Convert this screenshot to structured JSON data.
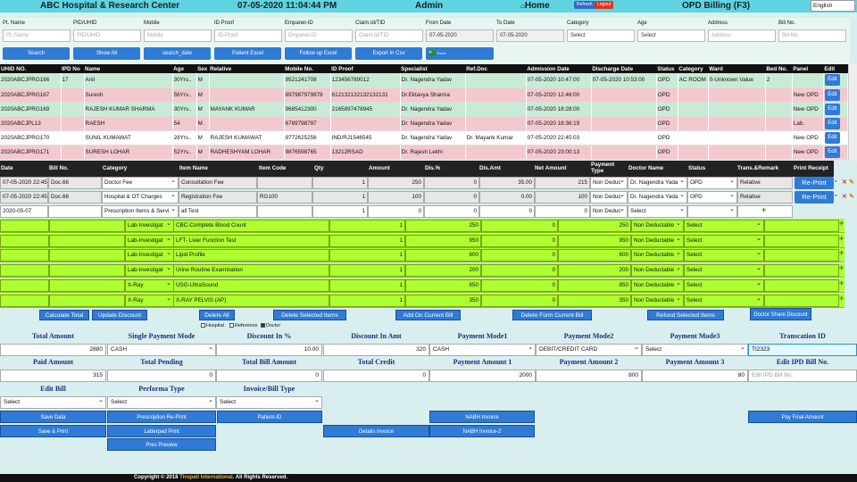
{
  "header": {
    "title": "ABC Hospital & Research Center",
    "datetime": "07-05-2020 11:04:44 PM",
    "user": "Admin",
    "home": "Home",
    "refresh": "Refresh",
    "logout": "Logout",
    "page": "OPD Billing (F3)",
    "language": "English"
  },
  "filters": {
    "labels": [
      "Pt. Name",
      "PID/UHID",
      "Mobile",
      "ID Proof",
      "Empanel-ID",
      "Claim.Id/TID",
      "From Date",
      "To Date",
      "Category",
      "Age",
      "Address",
      "Bill No."
    ],
    "placeholders": [
      "Pt. Name",
      "PID/UHID",
      "Mobile",
      "ID-Proof",
      "Empanel-ID",
      "Claim.Id/TID",
      "07-05-2020",
      "07-05-2020",
      "Select",
      "Select",
      "Address",
      "Bill No."
    ],
    "buttons": [
      "Search",
      "Show All",
      "search_date",
      "Patient Excel",
      "Follow up Excel",
      "Export In Csv",
      "Excel"
    ]
  },
  "patients": {
    "headers": [
      "UHID NO.",
      "IPD No",
      "Name",
      "Age",
      "Sex",
      "Relative",
      "Mobile No.",
      "ID Proof",
      "Specialist",
      "Ref.Doc",
      "Admission Date",
      "Discharge Date",
      "Status",
      "Category",
      "Ward",
      "Bed No.",
      "Panel",
      "Edit"
    ],
    "rows": [
      [
        "2020ABCJPRG166",
        "17",
        "Anil",
        "30Yrs..",
        "M",
        "",
        "9521241708",
        "123456789012",
        "Dr. Nagendra Yadav",
        "",
        "07-05-2020 10:47:00",
        "07-05-2020 10:53:00",
        "OPD",
        "AC ROOM",
        "0-Unknown Value",
        "2",
        "",
        "Edit"
      ],
      [
        "2020ABCJPRG167",
        "",
        "Suresh",
        "56Yrs..",
        "M",
        "",
        "897987979878",
        "612132132132132131",
        "Dr.Ektavya Sharma",
        "",
        "07-05-2020 12:46:00",
        "",
        "OPD",
        "",
        "",
        "",
        "New OPD",
        "Edit"
      ],
      [
        "2020ABCJPRG169",
        "",
        "RAJESH KUMAR SHARMA",
        "30Yrs..",
        "M",
        "MAYANK KUMAR",
        "9685412300",
        "2165897478945",
        "Dr. Nagendra Yadav",
        "",
        "07-05-2020 18:28:00",
        "",
        "OPD",
        "",
        "",
        "",
        "New OPD",
        "Edit"
      ],
      [
        "2020ABCJPL13",
        "",
        "RAESH",
        "54",
        "M",
        "",
        "6789798797",
        "",
        "Dr. Nagendra Yadav",
        "",
        "07-05-2020 18:36:19",
        "",
        "OPD",
        "",
        "",
        "",
        "Lab.",
        "Edit"
      ],
      [
        "2020ABCJPRG170",
        "",
        "SUNIL KUMAWAT",
        "28Yrs..",
        "M",
        "RAJESH KUMAWAT",
        "9772625256",
        "IND/RJ1546545",
        "Dr. Nagendra Yadav",
        "Dr. Mayank Kumar",
        "07-05-2020 22:45:03",
        "",
        "OPD",
        "",
        "",
        "",
        "New OPD",
        "Edit"
      ],
      [
        "2020ABCJPRG171",
        "",
        "SURESH LOHAR",
        "52Yrs..",
        "M",
        "RADHESHYAM LOHAR",
        "9876598765",
        "13212RSAD",
        "Dr. Rajesh Lekhi",
        "",
        "07-05-2020 23:00:13",
        "",
        "OPD",
        "",
        "",
        "",
        "New OPD",
        "Edit"
      ]
    ]
  },
  "billing": {
    "headers": [
      "Date",
      "Bill No.",
      "Category",
      "Item Name",
      "Item Code",
      "Qty",
      "Amount",
      "Dis.%",
      "Dis.Amt",
      "Net Amount",
      "Payment Type",
      "Doctor Name",
      "Status",
      "Trans.&Remark",
      "Print Receipt"
    ],
    "rows": [
      {
        "date": "07-05-2020 22:45",
        "bill": "Doc.66",
        "category": "Doctor Fee",
        "item": "Consultation Fee",
        "code": "",
        "qty": "1",
        "amount": "250",
        "disp": "0",
        "disamt": "35.00",
        "net": "215",
        "ptype": "Non Deduc",
        "doctor": "Dr. Nagendra Yada",
        "status": "OPD",
        "remark": "Relative",
        "print": "Re-Print"
      },
      {
        "date": "07-05-2020 22:45",
        "bill": "Doc.66",
        "category": "Hospital & OT Charges",
        "item": "Registration Fee",
        "code": "RG100",
        "qty": "1",
        "amount": "100",
        "disp": "0",
        "disamt": "0.00",
        "net": "100",
        "ptype": "Non Deduc",
        "doctor": "Dr. Nagendra Yada",
        "status": "OPD",
        "remark": "Relative",
        "print": "Re-Print"
      },
      {
        "date": "2020-05-07",
        "bill": "",
        "category": "Prescription Items & Servi",
        "item": "all Test",
        "code": "",
        "qty": "1",
        "amount": "0",
        "disp": "0",
        "disamt": "0",
        "net": "0",
        "ptype": "Non Deduc",
        "doctor": "Select",
        "status": "",
        "remark": "",
        "print": ""
      }
    ]
  },
  "lab_rows": [
    {
      "category": "Lab-Investigat",
      "item": "CBC-Complete Blood Count",
      "qty": "1",
      "amount": "250",
      "dis": "0",
      "net": "250",
      "ptype": "Non Deductable",
      "doctor": "Select"
    },
    {
      "category": "Lab-Investigat",
      "item": "LFT- Liver Function Test",
      "qty": "1",
      "amount": "950",
      "dis": "0",
      "net": "950",
      "ptype": "Non Deductable",
      "doctor": "Select"
    },
    {
      "category": "Lab-Investigat",
      "item": "Lipid Profile",
      "qty": "1",
      "amount": "600",
      "dis": "0",
      "net": "600",
      "ptype": "Non Deductable",
      "doctor": "Select"
    },
    {
      "category": "Lab-Investigat",
      "item": "Urine Routine Examination",
      "qty": "1",
      "amount": "200",
      "dis": "0",
      "net": "200",
      "ptype": "Non Deductable",
      "doctor": "Select"
    },
    {
      "category": "X-Ray",
      "item": "USG-UltraSound",
      "qty": "1",
      "amount": "850",
      "dis": "0",
      "net": "850",
      "ptype": "Non Deductable",
      "doctor": "Select"
    },
    {
      "category": "X-Ray",
      "item": "X-RAY PELVIS (AP)",
      "qty": "1",
      "amount": "350",
      "dis": "0",
      "net": "350",
      "ptype": "Non Deductable",
      "doctor": "Select"
    }
  ],
  "actions": [
    "Calculate Total",
    "Update Discount",
    "Delete All",
    "Delete Selected Items",
    "Add On Current Bill",
    "Delete Form Current Bill",
    "Refund Selected Items",
    "Doctor Share Discount"
  ],
  "checks": [
    "Hospital",
    "Reference",
    "Doctor"
  ],
  "summary": {
    "row1_labels": [
      "Total Amount",
      "Single Payment Mode",
      "Discount In %",
      "Discount In Amt",
      "Payment Mode1",
      "Payment Mode2",
      "Payment Mode3",
      "Transcation ID"
    ],
    "row1_values": [
      "2880",
      "CASH",
      "10.00",
      "320",
      "CASH",
      "DEBIT/CREDIT CARD",
      "Select",
      "TI2323"
    ],
    "row2_labels": [
      "Paid Amount",
      "Total Pending",
      "Total Bill Amount",
      "Total Credit",
      "Payment Amount 1",
      "Payment Amount 2",
      "Payment Amount 3",
      "Edit IPD Bill No."
    ],
    "row2_values": [
      "315",
      "0",
      "0",
      "0",
      "2000",
      "800",
      "80",
      "Edit IPD Bill No."
    ],
    "row3_labels": [
      "Edit Bill",
      "Performa Type",
      "Invoice/Bill Type"
    ],
    "row3_values": [
      "Select",
      "Select",
      "Select"
    ]
  },
  "bottom_buttons": {
    "save_data": "Save Data",
    "prescription": "Prescription Re-Print",
    "patient_id": "Patient-ID",
    "nabh": "NABH Invoice",
    "pay_final": "Pay Final Amount",
    "save_print": "Save & Print",
    "letterpad": "Latterpad Print",
    "details": "Details Invoice",
    "nabh2": "NABH Invoice-2",
    "pres_preview": "Pres Preview"
  },
  "footer": {
    "prefix": "Copyright © 2018 ",
    "company": "Tirupati International",
    "suffix": ". All Rights Reserved."
  }
}
